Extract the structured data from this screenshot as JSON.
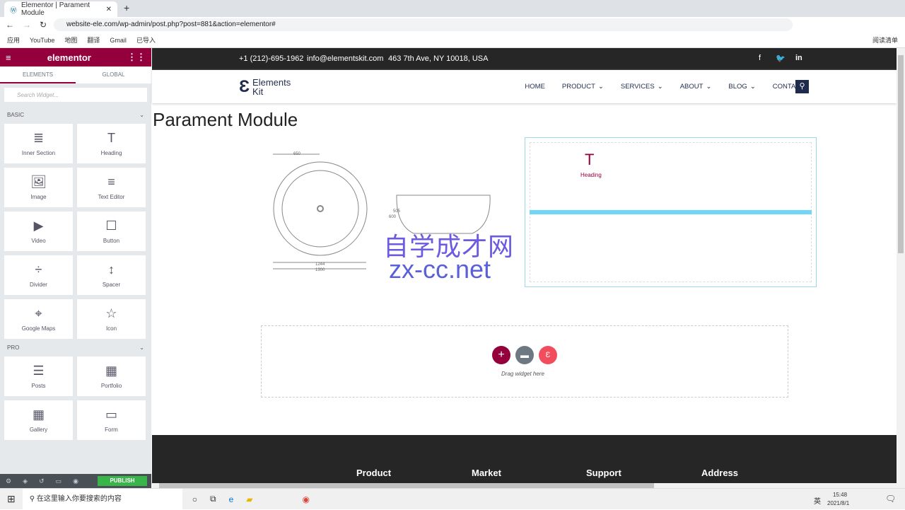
{
  "browser": {
    "tab_title": "Elementor | Parament Module",
    "url": "website-ele.com/wp-admin/post.php?post=881&action=elementor#",
    "bookmarks": [
      "应用",
      "YouTube",
      "地图",
      "翻译",
      "Gmail",
      "已导入"
    ],
    "reading_list": "阅读清单"
  },
  "panel": {
    "brand": "elementor",
    "tabs": [
      "ELEMENTS",
      "GLOBAL"
    ],
    "search_placeholder": "Search Widget...",
    "basic_label": "BASIC",
    "pro_label": "PRO",
    "basic": [
      {
        "label": "Inner Section",
        "icon": "≣"
      },
      {
        "label": "Heading",
        "icon": "T"
      },
      {
        "label": "Image",
        "icon": "🖼"
      },
      {
        "label": "Text Editor",
        "icon": "≡"
      },
      {
        "label": "Video",
        "icon": "▶"
      },
      {
        "label": "Button",
        "icon": "☐"
      },
      {
        "label": "Divider",
        "icon": "÷"
      },
      {
        "label": "Spacer",
        "icon": "↕"
      },
      {
        "label": "Google Maps",
        "icon": "⌖"
      },
      {
        "label": "Icon",
        "icon": "☆"
      }
    ],
    "pro": [
      {
        "label": "Posts",
        "icon": "☰"
      },
      {
        "label": "Portfolio",
        "icon": "▦"
      },
      {
        "label": "Gallery",
        "icon": "▦"
      },
      {
        "label": "Form",
        "icon": "▭"
      }
    ],
    "publish": "PUBLISH",
    "accent": "#93003c"
  },
  "site": {
    "phone": "+1 (212)-695-1962",
    "email": "info@elementskit.com",
    "address": "463 7th Ave, NY 10018, USA",
    "logo": "Elements Kit",
    "nav": [
      "HOME",
      "PRODUCT",
      "SERVICES",
      "ABOUT",
      "BLOG",
      "CONTACT"
    ],
    "page_title": "Parament Module",
    "drop_text": "Drag widget here",
    "heading_ghost": "Heading",
    "dims": {
      "top": "650",
      "bottom1": "1244",
      "bottom2": "1300",
      "h1": "600",
      "h2": "505"
    },
    "watermark_cn": "自学成才网",
    "watermark_en": "zx-cc.net",
    "footer": [
      "Product",
      "Market",
      "Support",
      "Address"
    ]
  },
  "taskbar": {
    "search": "在这里输入你要搜索的内容",
    "time": "15:48",
    "date": "2021/8/1",
    "ime": "英"
  }
}
